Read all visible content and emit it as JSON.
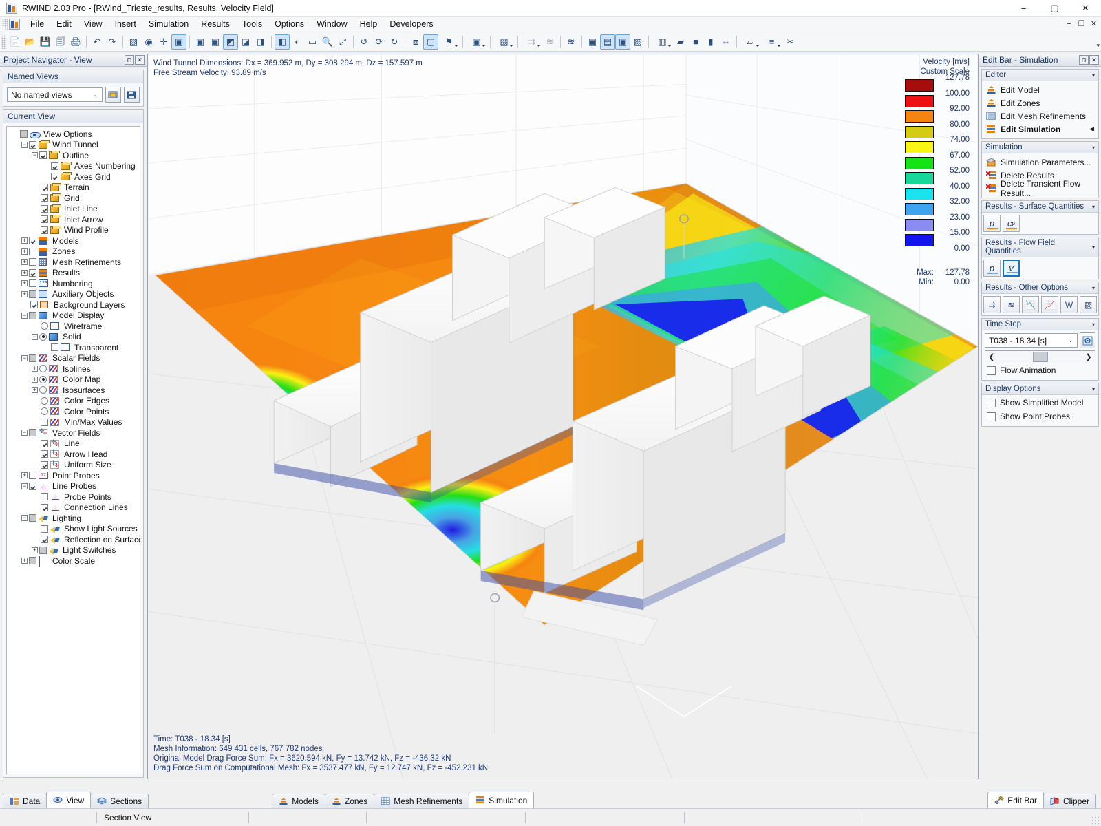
{
  "window": {
    "title": "RWIND 2.03 Pro - [RWind_Trieste_results, Results, Velocity Field]",
    "minimize": "−",
    "maximize": "▢",
    "close": "✕",
    "mdi_minimize": "−",
    "mdi_restore": "❐",
    "mdi_close": "✕"
  },
  "menu": {
    "items": [
      "File",
      "Edit",
      "View",
      "Insert",
      "Simulation",
      "Results",
      "Tools",
      "Options",
      "Window",
      "Help",
      "Developers"
    ]
  },
  "toolbar": {
    "overflow": "▾",
    "groups": [
      {
        "buttons": [
          {
            "name": "new-file-icon",
            "glyph": "📄",
            "state": "normal"
          },
          {
            "name": "open-file-icon",
            "glyph": "📂",
            "state": "normal"
          },
          {
            "name": "save-icon",
            "glyph": "💾",
            "state": "normal"
          },
          {
            "name": "print-preview-icon",
            "glyph": "🗐",
            "state": "normal"
          },
          {
            "name": "print-icon",
            "glyph": "🖨",
            "state": "normal"
          }
        ]
      },
      {
        "buttons": [
          {
            "name": "undo-icon",
            "glyph": "↶",
            "state": "normal"
          },
          {
            "name": "redo-icon",
            "glyph": "↷",
            "state": "normal"
          }
        ]
      },
      {
        "buttons": [
          {
            "name": "render-settings-icon",
            "glyph": "▨",
            "state": "normal"
          },
          {
            "name": "view-eye-icon",
            "glyph": "◉",
            "state": "normal"
          },
          {
            "name": "snap-icon",
            "glyph": "✛",
            "state": "normal"
          },
          {
            "name": "selection-box-icon",
            "glyph": "▣",
            "state": "active"
          }
        ]
      },
      {
        "buttons": [
          {
            "name": "select-cursor-icon",
            "glyph": "▣",
            "state": "normal"
          },
          {
            "name": "deselect-icon",
            "glyph": "▣",
            "state": "normal"
          },
          {
            "name": "view-axis-x-icon",
            "glyph": "◩",
            "state": "active"
          },
          {
            "name": "view-axis-y-icon",
            "glyph": "◪",
            "state": "normal"
          },
          {
            "name": "view-axis-z-icon",
            "glyph": "◨",
            "state": "normal"
          }
        ]
      },
      {
        "buttons": [
          {
            "name": "view-isometric-icon",
            "glyph": "◧",
            "state": "active"
          },
          {
            "name": "render-mode-icon",
            "glyph": "◐",
            "state": "normal"
          },
          {
            "name": "zoom-window-icon",
            "glyph": "▭",
            "state": "normal"
          },
          {
            "name": "zoom-icon",
            "glyph": "🔍",
            "state": "normal"
          },
          {
            "name": "zoom-all-icon",
            "glyph": "⤢",
            "state": "normal"
          }
        ]
      },
      {
        "buttons": [
          {
            "name": "rotate-left-icon",
            "glyph": "↺",
            "state": "normal"
          },
          {
            "name": "rotate-reset-icon",
            "glyph": "⟳",
            "state": "normal"
          },
          {
            "name": "rotate-right-icon",
            "glyph": "↻",
            "state": "normal"
          }
        ]
      },
      {
        "buttons": [
          {
            "name": "wireframe-view-icon",
            "glyph": "⧈",
            "state": "normal"
          },
          {
            "name": "solid-view-icon",
            "glyph": "▢",
            "state": "active"
          },
          {
            "name": "color-marker-icon",
            "glyph": "⚑",
            "state": "dropdown"
          }
        ]
      },
      {
        "buttons": [
          {
            "name": "model-display-icon",
            "glyph": "▣",
            "state": "dropdown"
          }
        ]
      },
      {
        "buttons": [
          {
            "name": "scalar-field-icon",
            "glyph": "▨",
            "state": "dropdown"
          }
        ]
      },
      {
        "buttons": [
          {
            "name": "flow-lines-icon",
            "glyph": "⇉",
            "state": "disabled-dropdown"
          },
          {
            "name": "iso-surface-icon",
            "glyph": "≋",
            "state": "disabled"
          }
        ]
      },
      {
        "buttons": [
          {
            "name": "iso-surface-2-icon",
            "glyph": "≋",
            "state": "normal"
          }
        ]
      },
      {
        "buttons": [
          {
            "name": "result-cube-icon",
            "glyph": "▣",
            "state": "normal"
          },
          {
            "name": "result-model-icon",
            "glyph": "▤",
            "state": "active"
          },
          {
            "name": "result-square-icon",
            "glyph": "▣",
            "state": "active"
          },
          {
            "name": "result-paint-icon",
            "glyph": "▨",
            "state": "normal"
          }
        ]
      },
      {
        "buttons": [
          {
            "name": "section-cube-icon",
            "glyph": "▥",
            "state": "dropdown"
          },
          {
            "name": "section-plane-x-icon",
            "glyph": "▰",
            "state": "normal"
          },
          {
            "name": "section-plane-y-icon",
            "glyph": "■",
            "state": "normal"
          },
          {
            "name": "section-plane-z-icon",
            "glyph": "▮",
            "state": "normal"
          },
          {
            "name": "section-mirror-icon",
            "glyph": "⇔",
            "state": "normal"
          }
        ]
      },
      {
        "buttons": [
          {
            "name": "note-icon",
            "glyph": "▱",
            "state": "dropdown"
          },
          {
            "name": "dimension-icon",
            "glyph": "≡",
            "state": "dropdown"
          },
          {
            "name": "delete-tools-icon",
            "glyph": "✂",
            "state": "normal"
          }
        ]
      }
    ]
  },
  "left_panel": {
    "title": "Project Navigator - View",
    "pin_btn": "⊓",
    "close_btn": "✕",
    "named_views": {
      "header": "Named Views",
      "selected": "No named views",
      "arrow": "⌄",
      "btn1_name": "apply-named-view-icon",
      "btn2_name": "save-named-view-icon"
    },
    "current_view": {
      "header": "Current View"
    },
    "tree": [
      {
        "label": "View Options",
        "depth": 0,
        "exp": "none",
        "ctrl": "cb-grey",
        "icon": "ic-eye"
      },
      {
        "label": "Wind Tunnel",
        "depth": 1,
        "exp": "minus",
        "ctrl": "cb-checked",
        "icon": "ic-cube"
      },
      {
        "label": "Outline",
        "depth": 2,
        "exp": "minus",
        "ctrl": "cb-checked",
        "icon": "ic-cube"
      },
      {
        "label": "Axes Numbering",
        "depth": 3,
        "exp": "none",
        "ctrl": "cb-checked",
        "icon": "ic-cube"
      },
      {
        "label": "Axes Grid",
        "depth": 3,
        "exp": "none",
        "ctrl": "cb-checked",
        "icon": "ic-cube"
      },
      {
        "label": "Terrain",
        "depth": 2,
        "exp": "none",
        "ctrl": "cb-checked",
        "icon": "ic-cube"
      },
      {
        "label": "Grid",
        "depth": 2,
        "exp": "none",
        "ctrl": "cb-checked",
        "icon": "ic-cube"
      },
      {
        "label": "Inlet Line",
        "depth": 2,
        "exp": "none",
        "ctrl": "cb-checked",
        "icon": "ic-cube"
      },
      {
        "label": "Inlet Arrow",
        "depth": 2,
        "exp": "none",
        "ctrl": "cb-checked",
        "icon": "ic-cube"
      },
      {
        "label": "Wind Profile",
        "depth": 2,
        "exp": "none",
        "ctrl": "cb-checked",
        "icon": "ic-cube"
      },
      {
        "label": "Models",
        "depth": 1,
        "exp": "plus",
        "ctrl": "cb-checked",
        "icon": "ic-model"
      },
      {
        "label": "Zones",
        "depth": 1,
        "exp": "plus",
        "ctrl": "cb",
        "icon": "ic-model"
      },
      {
        "label": "Mesh Refinements",
        "depth": 1,
        "exp": "plus",
        "ctrl": "cb",
        "icon": "ic-mesh"
      },
      {
        "label": "Results",
        "depth": 1,
        "exp": "plus",
        "ctrl": "cb-checked",
        "icon": "ic-results"
      },
      {
        "label": "Numbering",
        "depth": 1,
        "exp": "plus",
        "ctrl": "cb",
        "icon": "ic-num",
        "icon_text": "123"
      },
      {
        "label": "Auxiliary Objects",
        "depth": 1,
        "exp": "plus",
        "ctrl": "cb-grey",
        "icon": "ic-aux"
      },
      {
        "label": "Background Layers",
        "depth": 1,
        "exp": "none",
        "ctrl": "cb-checked",
        "icon": "ic-bg"
      },
      {
        "label": "Model Display",
        "depth": 1,
        "exp": "minus",
        "ctrl": "cb-grey",
        "icon": "ic-disp"
      },
      {
        "label": "Wireframe",
        "depth": 2,
        "exp": "none",
        "ctrl": "radio",
        "icon": "ic-wf"
      },
      {
        "label": "Solid",
        "depth": 2,
        "exp": "minus",
        "ctrl": "radio-sel",
        "icon": "ic-disp"
      },
      {
        "label": "Transparent",
        "depth": 3,
        "exp": "none",
        "ctrl": "cb",
        "icon": "ic-wf"
      },
      {
        "label": "Scalar Fields",
        "depth": 1,
        "exp": "minus",
        "ctrl": "cb-grey",
        "icon": "ic-scalar"
      },
      {
        "label": "Isolines",
        "depth": 2,
        "exp": "plus",
        "ctrl": "radio",
        "icon": "ic-scalar"
      },
      {
        "label": "Color Map",
        "depth": 2,
        "exp": "plus",
        "ctrl": "radio-sel",
        "icon": "ic-scalar"
      },
      {
        "label": "Isosurfaces",
        "depth": 2,
        "exp": "plus",
        "ctrl": "radio",
        "icon": "ic-scalar"
      },
      {
        "label": "Color Edges",
        "depth": 2,
        "exp": "none",
        "ctrl": "radio",
        "icon": "ic-scalar"
      },
      {
        "label": "Color Points",
        "depth": 2,
        "exp": "none",
        "ctrl": "radio",
        "icon": "ic-scalar"
      },
      {
        "label": "Min/Max Values",
        "depth": 2,
        "exp": "none",
        "ctrl": "cb",
        "icon": "ic-scalar"
      },
      {
        "label": "Vector Fields",
        "depth": 1,
        "exp": "minus",
        "ctrl": "cb-grey",
        "icon": "ic-vector"
      },
      {
        "label": "Line",
        "depth": 2,
        "exp": "none",
        "ctrl": "cb-checked",
        "icon": "ic-vector"
      },
      {
        "label": "Arrow Head",
        "depth": 2,
        "exp": "none",
        "ctrl": "cb-checked",
        "icon": "ic-vector"
      },
      {
        "label": "Uniform Size",
        "depth": 2,
        "exp": "none",
        "ctrl": "cb-checked",
        "icon": "ic-vector"
      },
      {
        "label": "Point Probes",
        "depth": 1,
        "exp": "plus",
        "ctrl": "cb",
        "icon": "ic-probe",
        "icon_text": "12"
      },
      {
        "label": "Line Probes",
        "depth": 1,
        "exp": "minus",
        "ctrl": "cb-checked",
        "icon": "ic-tri"
      },
      {
        "label": "Probe Points",
        "depth": 2,
        "exp": "none",
        "ctrl": "cb",
        "icon": "ic-tri"
      },
      {
        "label": "Connection Lines",
        "depth": 2,
        "exp": "none",
        "ctrl": "cb-checked",
        "icon": "ic-tri"
      },
      {
        "label": "Lighting",
        "depth": 1,
        "exp": "minus",
        "ctrl": "cb-grey",
        "icon": "ic-light"
      },
      {
        "label": "Show Light Sources",
        "depth": 2,
        "exp": "none",
        "ctrl": "cb",
        "icon": "ic-light"
      },
      {
        "label": "Reflection on Surfaces",
        "depth": 2,
        "exp": "none",
        "ctrl": "cb-checked",
        "icon": "ic-light"
      },
      {
        "label": "Light Switches",
        "depth": 2,
        "exp": "plus",
        "ctrl": "cb-grey",
        "icon": "ic-light"
      },
      {
        "label": "Color Scale",
        "depth": 1,
        "exp": "plus",
        "ctrl": "cb-grey",
        "icon": "ic-cs"
      }
    ]
  },
  "viewport": {
    "info_lines": [
      "Wind Tunnel Dimensions: Dx = 369.952 m, Dy = 308.294 m, Dz = 157.597 m",
      "Free Stream Velocity: 93.89 m/s"
    ],
    "status_lines": [
      "Time: T038 - 18.34 [s]",
      "Mesh Information: 649 431 cells, 767 782 nodes",
      "Original Model Drag Force Sum: Fx = 3620.594 kN, Fy = 13.742 kN, Fz = -436.32 kN",
      "Drag Force Sum on Computational Mesh: Fx = 3537.477 kN, Fy = 12.747 kN, Fz = -452.231 kN"
    ]
  },
  "legend": {
    "title": "Velocity [m/s]",
    "subtitle": "Custom Scale",
    "max_label": "Max:",
    "max_value": "127.78",
    "min_label": "Min:",
    "min_value": "0.00",
    "entries": [
      {
        "value": "127.78",
        "color": "#a70d0d"
      },
      {
        "value": "100.00",
        "color": "#ee1111"
      },
      {
        "value": "92.00",
        "color": "#f58410"
      },
      {
        "value": "80.00",
        "color": "#d4cc12"
      },
      {
        "value": "74.00",
        "color": "#fbf515"
      },
      {
        "value": "67.00",
        "color": "#16e316"
      },
      {
        "value": "52.00",
        "color": "#18d79a"
      },
      {
        "value": "40.00",
        "color": "#1ae2ef"
      },
      {
        "value": "32.00",
        "color": "#3fa4ef"
      },
      {
        "value": "23.00",
        "color": "#8a8cf2"
      },
      {
        "value": "15.00",
        "color": "#1414ef"
      },
      {
        "value": "0.00",
        "color": null
      }
    ]
  },
  "right_panel": {
    "title": "Edit Bar - Simulation",
    "pin_btn": "⊓",
    "close_btn": "✕",
    "sections": {
      "editor": {
        "header": "Editor",
        "collapse": "▾",
        "items": [
          {
            "label": "Edit Model",
            "icon": "ic-model",
            "bold": false,
            "arrow": ""
          },
          {
            "label": "Edit Zones",
            "icon": "ic-model",
            "bold": false,
            "arrow": ""
          },
          {
            "label": "Edit Mesh Refinements",
            "icon": "ic-mesh",
            "bold": false,
            "arrow": ""
          },
          {
            "label": "Edit Simulation",
            "icon": "ic-results",
            "bold": true,
            "arrow": "◀"
          }
        ]
      },
      "simulation": {
        "header": "Simulation",
        "collapse": "▾",
        "items": [
          {
            "label": "Simulation Parameters...",
            "icon": "ic-simparams",
            "bold": false,
            "arrow": ""
          },
          {
            "label": "Delete Results",
            "icon": "ic-delres",
            "bold": false,
            "arrow": ""
          },
          {
            "label": "Delete Transient Flow Result...",
            "icon": "ic-delres2",
            "bold": false,
            "arrow": ""
          }
        ]
      },
      "surface_quantities": {
        "header": "Results - Surface Quantities",
        "collapse": "▾",
        "buttons": [
          {
            "label": "p",
            "sub": "",
            "name": "surface-pressure-button",
            "selected": false,
            "underline": "#e8820c"
          },
          {
            "label": "c",
            "sub": "p",
            "name": "surface-cp-button",
            "selected": false,
            "underline": "#e8820c"
          }
        ]
      },
      "flow_quantities": {
        "header": "Results - Flow Field Quantities",
        "collapse": "▾",
        "buttons": [
          {
            "label": "p",
            "sub": "",
            "name": "flow-pressure-button",
            "selected": false,
            "underline": "#6fa5d8"
          },
          {
            "label": "v",
            "sub": "",
            "name": "flow-velocity-button",
            "selected": true,
            "underline": "#6fa5d8"
          }
        ]
      },
      "other_options": {
        "header": "Results - Other Options",
        "collapse": "▾",
        "buttons": [
          {
            "name": "flow-lines-button",
            "glyph": "⇉"
          },
          {
            "name": "iso-surface-button",
            "glyph": "≋"
          },
          {
            "name": "result-diagram-button",
            "glyph": "📉"
          },
          {
            "name": "result-graph-button",
            "glyph": "📈"
          },
          {
            "name": "export-word-button",
            "glyph": "W"
          },
          {
            "name": "result-settings-button",
            "glyph": "▨"
          }
        ]
      },
      "time_step": {
        "header": "Time Step",
        "collapse": "▾",
        "selected": "T038 - 18.34 [s]",
        "arrow": "⌄",
        "settings_btn_name": "time-step-settings-button",
        "slider_left": "❮",
        "slider_right": "❯",
        "flow_animation_label": "Flow Animation",
        "flow_animation_checked": false
      },
      "display_options": {
        "header": "Display Options",
        "collapse": "▾",
        "items": [
          {
            "label": "Show Simplified Model",
            "checked": false
          },
          {
            "label": "Show Point Probes",
            "checked": false
          }
        ]
      }
    }
  },
  "bottom_tabs": {
    "left": [
      {
        "label": "Data",
        "active": false,
        "icon": "tab-data"
      },
      {
        "label": "View",
        "active": true,
        "icon": "tab-view"
      },
      {
        "label": "Sections",
        "active": false,
        "icon": "tab-sections"
      }
    ],
    "center": [
      {
        "label": "Models",
        "active": false,
        "icon": "tab-models"
      },
      {
        "label": "Zones",
        "active": false,
        "icon": "tab-zones"
      },
      {
        "label": "Mesh Refinements",
        "active": false,
        "icon": "tab-mesh"
      },
      {
        "label": "Simulation",
        "active": true,
        "icon": "tab-simulation"
      }
    ],
    "right": [
      {
        "label": "Edit Bar",
        "active": true,
        "icon": "tab-editbar"
      },
      {
        "label": "Clipper",
        "active": false,
        "icon": "tab-clipper"
      }
    ]
  },
  "statusbar": {
    "cells": [
      "",
      "Section View",
      "",
      "",
      "",
      ""
    ]
  }
}
